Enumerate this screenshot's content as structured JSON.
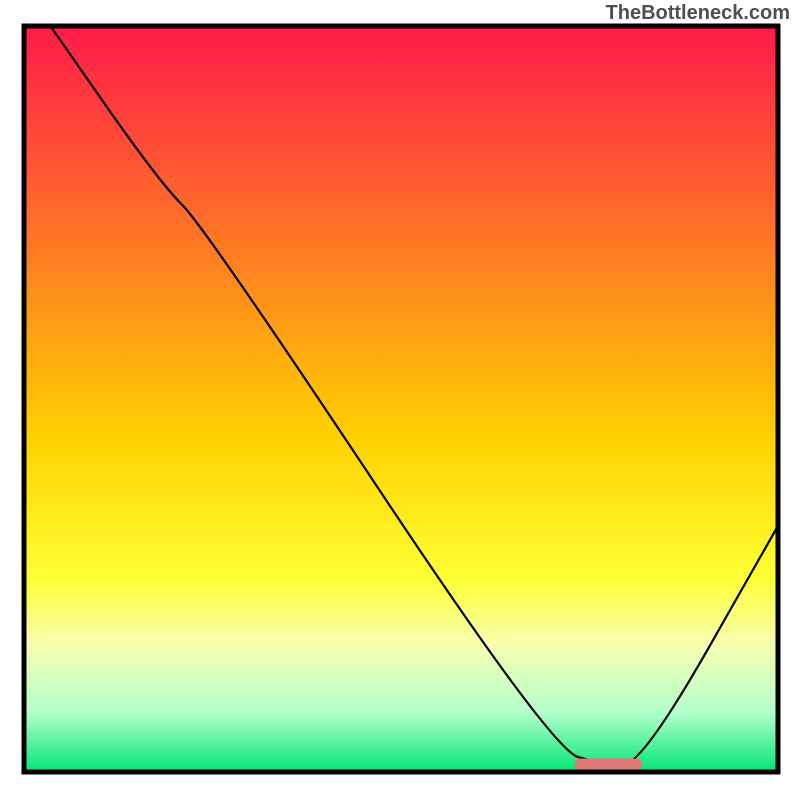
{
  "watermark": "TheBottleneck.com",
  "chart_data": {
    "type": "line",
    "title": "",
    "xlabel": "",
    "ylabel": "",
    "xlim": [
      0,
      100
    ],
    "ylim": [
      0,
      100
    ],
    "gradient_stops": [
      {
        "offset": 0,
        "color": "#ff1a4a"
      },
      {
        "offset": 25,
        "color": "#ff6a2a"
      },
      {
        "offset": 55,
        "color": "#ffd000"
      },
      {
        "offset": 74,
        "color": "#ffff33"
      },
      {
        "offset": 83,
        "color": "#f7ffb0"
      },
      {
        "offset": 92,
        "color": "#b3ffcc"
      },
      {
        "offset": 100,
        "color": "#00e676"
      }
    ],
    "series": [
      {
        "name": "bottleneck-curve",
        "x": [
          3.5,
          18,
          24,
          70,
          77,
          82,
          100
        ],
        "y": [
          100,
          79,
          73,
          3,
          1,
          1,
          33
        ]
      }
    ],
    "marker": {
      "x_start": 73,
      "x_end": 82,
      "y": 1,
      "color": "#e07878"
    }
  }
}
